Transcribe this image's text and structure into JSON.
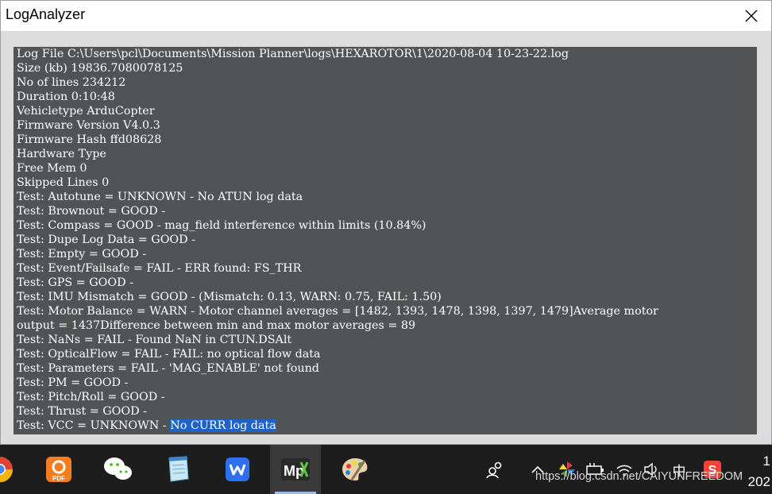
{
  "window": {
    "title": "LogAnalyzer"
  },
  "log": {
    "lines": [
      "Log File C:\\Users\\pcl\\Documents\\Mission Planner\\logs\\HEXAROTOR\\1\\2020-08-04 10-23-22.log",
      "Size (kb) 19836.7080078125",
      "No of lines 234212",
      "Duration 0:10:48",
      "Vehicletype ArduCopter",
      "Firmware Version V4.0.3",
      "Firmware Hash ffd08628",
      "Hardware Type",
      "Free Mem 0",
      "Skipped Lines 0",
      "Test: Autotune = UNKNOWN - No ATUN log data",
      "Test: Brownout = GOOD -",
      "Test: Compass = GOOD - mag_field interference within limits (10.84%)",
      "Test: Dupe Log Data = GOOD -",
      "Test: Empty = GOOD -",
      "Test: Event/Failsafe = FAIL - ERR found: FS_THR",
      "Test: GPS = GOOD -",
      "Test: IMU Mismatch = GOOD - (Mismatch: 0.13, WARN: 0.75, FAIL: 1.50)",
      "Test: Motor Balance = WARN - Motor channel averages = [1482, 1393, 1478, 1398, 1397, 1479]Average motor",
      "output = 1437Difference between min and max motor averages = 89",
      "Test: NaNs = FAIL - Found NaN in CTUN.DSAlt",
      "Test: OpticalFlow = FAIL - FAIL: no optical flow data",
      "Test: Parameters = FAIL - 'MAG_ENABLE' not found",
      "Test: PM = GOOD -",
      "Test: Pitch/Roll = GOOD -",
      "Test: Thrust = GOOD -"
    ],
    "last_line_prefix": "Test: VCC = UNKNOWN - ",
    "last_line_selected": "No CURR log data"
  },
  "taskbar": {
    "apps": [
      {
        "icon": "chrome-icon",
        "active": false
      },
      {
        "icon": "pdf-icon",
        "label": "PDF",
        "active": false
      },
      {
        "icon": "wechat-icon",
        "active": false
      },
      {
        "icon": "notepad-icon",
        "active": false
      },
      {
        "icon": "wps-icon",
        "active": false
      },
      {
        "icon": "mission-planner-icon",
        "label": "Mp",
        "active": true
      },
      {
        "icon": "paint-icon",
        "active": false
      }
    ],
    "tray_icons": [
      "people-icon",
      "chevron-up-icon",
      "pinwheel-icon",
      "power-icon",
      "wifi-icon",
      "volume-icon",
      "ime-icon",
      "sogou-icon"
    ],
    "ime_label": "中",
    "sogou_label": "S",
    "watermark": "https://blog.csdn.net/CAIYUNFREEDOM",
    "clock_line1": "1",
    "clock_line2": "202"
  },
  "colors": {
    "log_background": "#515355",
    "selection": "#1e63c8",
    "taskbar": "#1d1d1d"
  }
}
